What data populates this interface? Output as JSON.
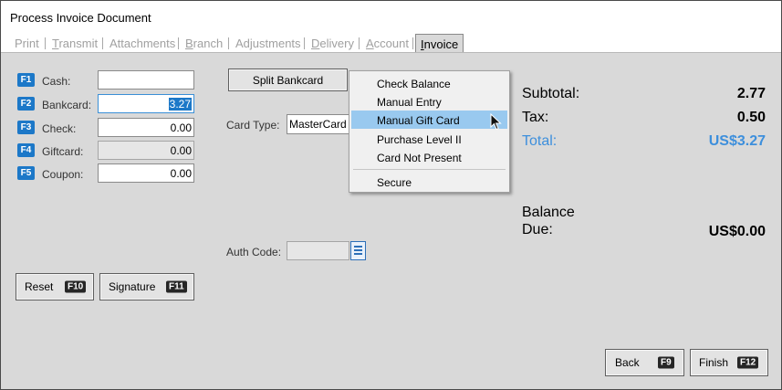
{
  "window": {
    "title": "Process Invoice Document"
  },
  "tabs": [
    {
      "label": "Print",
      "ul": "",
      "rest": "Print"
    },
    {
      "label": "Transmit",
      "ul": "T",
      "rest": "ransmit"
    },
    {
      "label": "Attachments",
      "ul": "",
      "rest": "Attachments"
    },
    {
      "label": "Branch",
      "ul": "B",
      "rest": "ranch"
    },
    {
      "label": "Adjustments",
      "ul": "",
      "rest": "Adjustments"
    },
    {
      "label": "Delivery",
      "ul": "D",
      "rest": "elivery"
    },
    {
      "label": "Account",
      "ul": "A",
      "rest": "ccount"
    },
    {
      "label": "Invoice",
      "ul": "I",
      "rest": "nvoice"
    }
  ],
  "payments": [
    {
      "key": "F1",
      "label": "Cash:",
      "value": ""
    },
    {
      "key": "F2",
      "label": "Bankcard:",
      "value": "3.27"
    },
    {
      "key": "F3",
      "label": "Check:",
      "value": "0.00"
    },
    {
      "key": "F4",
      "label": "Giftcard:",
      "value": "0.00"
    },
    {
      "key": "F5",
      "label": "Coupon:",
      "value": "0.00"
    }
  ],
  "buttons": {
    "reset": {
      "label": "Reset",
      "key": "F10"
    },
    "signature": {
      "label": "Signature",
      "key": "F11"
    },
    "split_bankcard": "Split Bankcard",
    "back": {
      "label": "Back",
      "key": "F9"
    },
    "finish": {
      "label": "Finish",
      "key": "F12"
    }
  },
  "card": {
    "type_label": "Card Type:",
    "type_value": "MasterCard",
    "auth_label": "Auth Code:",
    "auth_value": ""
  },
  "menu": {
    "items": [
      "Check Balance",
      "Manual Entry",
      "Manual Gift Card",
      "Purchase Level II",
      "Card Not Present",
      "Secure"
    ],
    "highlighted": "Manual Gift Card"
  },
  "totals": {
    "subtotal_label": "Subtotal:",
    "subtotal": "2.77",
    "tax_label": "Tax:",
    "tax": "0.50",
    "total_label": "Total:",
    "total": "US$3.27",
    "balance_label_1": "Balance",
    "balance_label_2": "Due:",
    "balance_due": "US$0.00"
  },
  "colors": {
    "accent": "#1c78c8",
    "menu_highlight": "#99c9ef",
    "total_text": "#3d8fdc"
  }
}
